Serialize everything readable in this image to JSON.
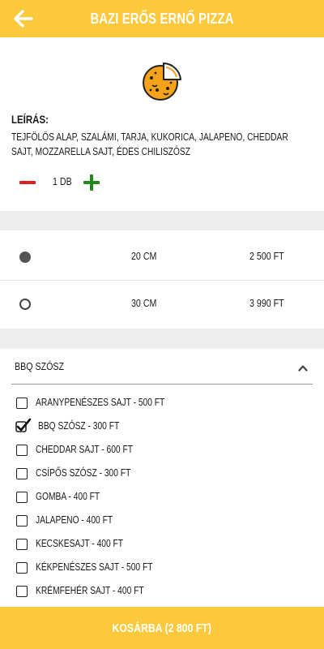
{
  "header": {
    "title": "BAZI ERŐS ERNŐ PIZZA",
    "back_icon": "arrow-left-icon"
  },
  "product": {
    "icon": "pizza-icon",
    "description_label": "LEÍRÁS:",
    "description": "TEJFÖLÖS ALAP, SZALÁMI, TARJA, KUKORICA, JALAPENO, CHEDDAR SAJT, MOZZARELLA SAJT, ÉDES CHILISZÓSZ",
    "quantity": "1 DB"
  },
  "sizes": [
    {
      "size": "20 CM",
      "price": "2 500 FT",
      "selected": true
    },
    {
      "size": "30 CM",
      "price": "3 990 FT",
      "selected": false
    }
  ],
  "extras": {
    "header": "BBQ SZÓSZ",
    "items": [
      {
        "label": "ARANYPENÉSZES SAJT - 500 FT",
        "checked": false
      },
      {
        "label": "BBQ SZÓSZ - 300 FT",
        "checked": true
      },
      {
        "label": "CHEDDAR SAJT - 600 FT",
        "checked": false
      },
      {
        "label": "CSÍPŐS SZÓSZ - 300 FT",
        "checked": false
      },
      {
        "label": "GOMBA - 400 FT",
        "checked": false
      },
      {
        "label": "JALAPENO - 400 FT",
        "checked": false
      },
      {
        "label": "KECSKESAJT - 400 FT",
        "checked": false
      },
      {
        "label": "KÉKPENÉSZES SAJT - 500 FT",
        "checked": false
      },
      {
        "label": "KRÉMFEHÉR SAJT - 400 FT",
        "checked": false
      }
    ]
  },
  "footer": {
    "button_label": "KOSÁRBA (2 800 FT)"
  },
  "colors": {
    "accent": "#fcc93c",
    "minus": "#e02020",
    "plus": "#1e8a1e"
  }
}
